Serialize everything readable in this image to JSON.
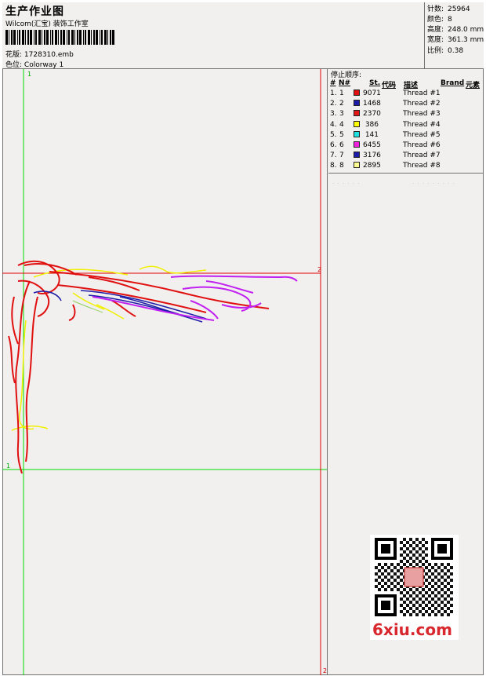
{
  "header": {
    "title": "生产作业图",
    "subtitle": "Wilcom(汇宝) 装饰工作室",
    "design_label": "花版:",
    "design_file": "1728310.emb",
    "colorway_label": "色位:",
    "colorway": "Colorway 1"
  },
  "stats": [
    {
      "key": "针数:",
      "value": "25964"
    },
    {
      "key": "颜色:",
      "value": "8"
    },
    {
      "key": "高度:",
      "value": "248.0 mm"
    },
    {
      "key": "宽度:",
      "value": "361.3 mm"
    },
    {
      "key": "比例:",
      "value": "0.38"
    }
  ],
  "stop_sequence": {
    "title": "停止顺序:",
    "headers": {
      "num": "#",
      "needle": "N#",
      "stitches": "St.",
      "code": "代码",
      "desc": "描述",
      "brand": "Brand",
      "element": "元素"
    },
    "rows": [
      {
        "num": "1.",
        "needle": "1",
        "color": "#e01010",
        "stitches": "9071",
        "desc": "Thread #1"
      },
      {
        "num": "2.",
        "needle": "2",
        "color": "#1c1ca8",
        "stitches": "1468",
        "desc": "Thread #2"
      },
      {
        "num": "3.",
        "needle": "3",
        "color": "#e01818",
        "stitches": "2370",
        "desc": "Thread #3"
      },
      {
        "num": "4.",
        "needle": "4",
        "color": "#ffff00",
        "stitches": "386",
        "desc": "Thread #4"
      },
      {
        "num": "5.",
        "needle": "5",
        "color": "#22e0e0",
        "stitches": "141",
        "desc": "Thread #5"
      },
      {
        "num": "6.",
        "needle": "6",
        "color": "#f020e0",
        "stitches": "6455",
        "desc": "Thread #6"
      },
      {
        "num": "7.",
        "needle": "7",
        "color": "#1c1ca8",
        "stitches": "3176",
        "desc": "Thread #7"
      },
      {
        "num": "8.",
        "needle": "8",
        "color": "#ffff90",
        "stitches": "2895",
        "desc": "Thread #8"
      }
    ]
  },
  "preview": {
    "guide_labels": {
      "top": "1",
      "left": "1",
      "right": "2",
      "bottom": "2"
    }
  },
  "watermark": {
    "logo_text": "6xiu.com"
  },
  "colors": {
    "guide_green": "#00dd00",
    "guide_red": "#e00000",
    "logo_red": "#d9272e"
  }
}
